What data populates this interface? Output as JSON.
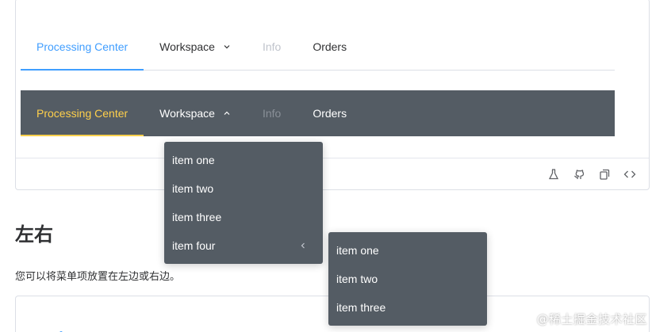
{
  "menu_light": {
    "items": [
      {
        "label": "Processing Center",
        "state": "active"
      },
      {
        "label": "Workspace",
        "state": "normal",
        "submenu": true
      },
      {
        "label": "Info",
        "state": "disabled"
      },
      {
        "label": "Orders",
        "state": "normal"
      }
    ],
    "active_color": "#409eff"
  },
  "menu_dark": {
    "items": [
      {
        "label": "Processing Center",
        "state": "active"
      },
      {
        "label": "Workspace",
        "state": "open",
        "submenu": true
      },
      {
        "label": "Info",
        "state": "disabled"
      },
      {
        "label": "Orders",
        "state": "normal"
      }
    ],
    "background": "#545c64",
    "active_color": "#ffd04b"
  },
  "dropdown": {
    "items": [
      "item one",
      "item two",
      "item three",
      "item four"
    ]
  },
  "submenu": {
    "items": [
      "item one",
      "item two",
      "item three"
    ]
  },
  "footer_icons": [
    "beaker-icon",
    "github-icon",
    "copy-icon",
    "code-icon"
  ],
  "section": {
    "heading": "左右",
    "description": "您可以将菜单项放置在左边或右边。"
  },
  "watermark": "@稀土掘金技术社区"
}
